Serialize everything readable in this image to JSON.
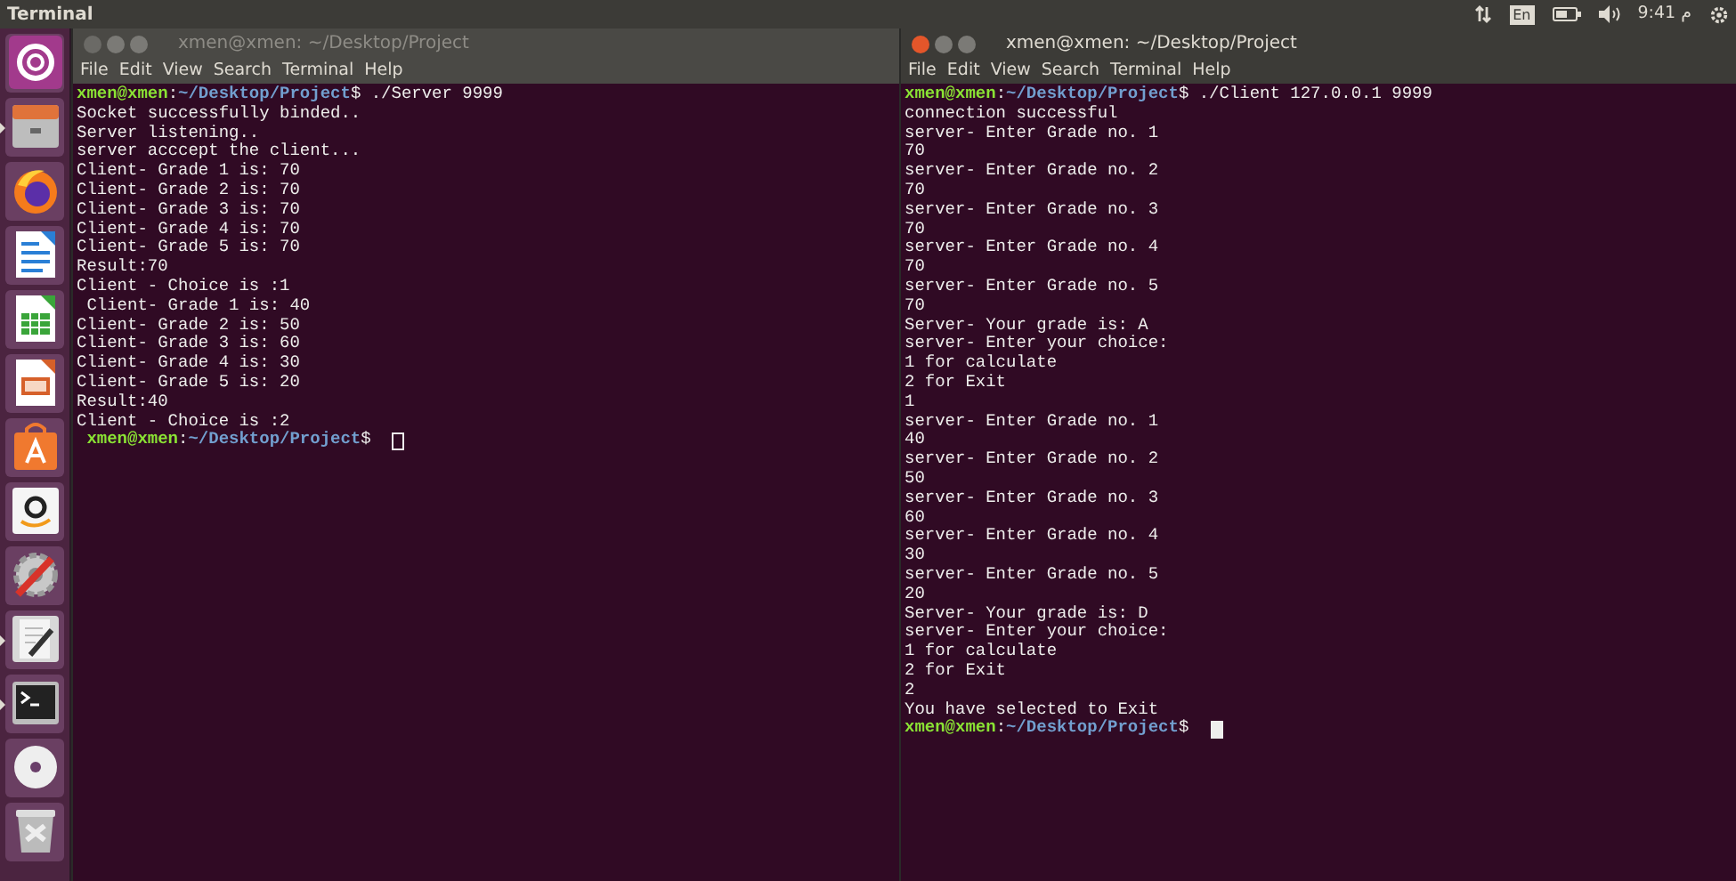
{
  "top_bar": {
    "title": "Terminal",
    "keyboard": "En",
    "clock": "م 9:41"
  },
  "launcher": [
    {
      "kind": "dash",
      "running": false
    },
    {
      "kind": "files",
      "running": true
    },
    {
      "kind": "browser",
      "running": false
    },
    {
      "kind": "writer",
      "running": false
    },
    {
      "kind": "calc",
      "running": false
    },
    {
      "kind": "impress",
      "running": false
    },
    {
      "kind": "store",
      "running": false
    },
    {
      "kind": "amazon",
      "running": false
    },
    {
      "kind": "settings",
      "running": false
    },
    {
      "kind": "editor",
      "running": true
    },
    {
      "kind": "terminal",
      "running": true
    },
    {
      "kind": "disc",
      "running": false
    },
    {
      "kind": "trash",
      "running": false
    }
  ],
  "windows": [
    {
      "title": "xmen@xmen: ~/Desktop/Project",
      "focused": false,
      "menu": [
        "File",
        "Edit",
        "View",
        "Search",
        "Terminal",
        "Help"
      ],
      "lines": [
        {
          "kind": "prompt",
          "user": "xmen@xmen",
          "sep": ":",
          "path": "~/Desktop/Project",
          "end": "$ ./Server 9999",
          "cursor": false
        },
        {
          "kind": "output",
          "text": "Socket successfully binded.."
        },
        {
          "kind": "output",
          "text": "Server listening.."
        },
        {
          "kind": "output",
          "text": "server acccept the client..."
        },
        {
          "kind": "output",
          "text": "Client- Grade 1 is: 70"
        },
        {
          "kind": "output",
          "text": "Client- Grade 2 is: 70"
        },
        {
          "kind": "output",
          "text": "Client- Grade 3 is: 70"
        },
        {
          "kind": "output",
          "text": "Client- Grade 4 is: 70"
        },
        {
          "kind": "output",
          "text": "Client- Grade 5 is: 70"
        },
        {
          "kind": "output",
          "text": "Result:70"
        },
        {
          "kind": "output",
          "text": "Client - Choice is :1"
        },
        {
          "kind": "output",
          "text": " Client- Grade 1 is: 40"
        },
        {
          "kind": "output",
          "text": "Client- Grade 2 is: 50"
        },
        {
          "kind": "output",
          "text": "Client- Grade 3 is: 60"
        },
        {
          "kind": "output",
          "text": "Client- Grade 4 is: 30"
        },
        {
          "kind": "output",
          "text": "Client- Grade 5 is: 20"
        },
        {
          "kind": "output",
          "text": "Result:40"
        },
        {
          "kind": "output",
          "text": "Client - Choice is :2"
        },
        {
          "kind": "prompt",
          "user": " xmen@xmen",
          "sep": ":",
          "path": "~/Desktop/Project",
          "end": "$",
          "cursor": true
        }
      ]
    },
    {
      "title": "xmen@xmen: ~/Desktop/Project",
      "focused": true,
      "menu": [
        "File",
        "Edit",
        "View",
        "Search",
        "Terminal",
        "Help"
      ],
      "lines": [
        {
          "kind": "prompt",
          "user": "xmen@xmen",
          "sep": ":",
          "path": "~/Desktop/Project",
          "end": "$ ./Client 127.0.0.1 9999",
          "cursor": false
        },
        {
          "kind": "output",
          "text": "connection successful"
        },
        {
          "kind": "output",
          "text": "server- Enter Grade no. 1"
        },
        {
          "kind": "output",
          "text": "70"
        },
        {
          "kind": "output",
          "text": "server- Enter Grade no. 2"
        },
        {
          "kind": "output",
          "text": "70"
        },
        {
          "kind": "output",
          "text": "server- Enter Grade no. 3"
        },
        {
          "kind": "output",
          "text": "70"
        },
        {
          "kind": "output",
          "text": "server- Enter Grade no. 4"
        },
        {
          "kind": "output",
          "text": "70"
        },
        {
          "kind": "output",
          "text": "server- Enter Grade no. 5"
        },
        {
          "kind": "output",
          "text": "70"
        },
        {
          "kind": "output",
          "text": "Server- Your grade is: A"
        },
        {
          "kind": "output",
          "text": "server- Enter your choice:"
        },
        {
          "kind": "output",
          "text": "1 for calculate"
        },
        {
          "kind": "output",
          "text": "2 for Exit"
        },
        {
          "kind": "output",
          "text": "1"
        },
        {
          "kind": "output",
          "text": "server- Enter Grade no. 1"
        },
        {
          "kind": "output",
          "text": "40"
        },
        {
          "kind": "output",
          "text": "server- Enter Grade no. 2"
        },
        {
          "kind": "output",
          "text": "50"
        },
        {
          "kind": "output",
          "text": "server- Enter Grade no. 3"
        },
        {
          "kind": "output",
          "text": "60"
        },
        {
          "kind": "output",
          "text": "server- Enter Grade no. 4"
        },
        {
          "kind": "output",
          "text": "30"
        },
        {
          "kind": "output",
          "text": "server- Enter Grade no. 5"
        },
        {
          "kind": "output",
          "text": "20"
        },
        {
          "kind": "output",
          "text": "Server- Your grade is: D"
        },
        {
          "kind": "output",
          "text": "server- Enter your choice:"
        },
        {
          "kind": "output",
          "text": "1 for calculate"
        },
        {
          "kind": "output",
          "text": "2 for Exit"
        },
        {
          "kind": "output",
          "text": "2"
        },
        {
          "kind": "output",
          "text": "You have selected to Exit"
        },
        {
          "kind": "prompt",
          "user": "xmen@xmen",
          "sep": ":",
          "path": "~/Desktop/Project",
          "end": "$",
          "cursor": true
        }
      ]
    }
  ]
}
